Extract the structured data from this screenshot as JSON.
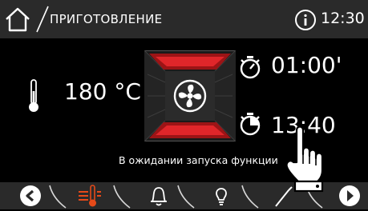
{
  "header": {
    "title": "ПРИГОТОВЛЕНИЕ",
    "time": "12:30"
  },
  "main": {
    "temperature": "180 °C",
    "duration": "01:00'",
    "end_time": "13:40",
    "status": "В ожидании запуска функции"
  },
  "icons": {
    "home": "home-icon",
    "info": "info-icon",
    "thermometer": "thermometer-icon",
    "fan": "fan-icon",
    "stopwatch": "stopwatch-icon",
    "end-time": "end-time-icon",
    "back": "back-icon",
    "heating": "heating-icon",
    "bell": "bell-icon",
    "lamp": "lamp-icon",
    "probe": "probe-icon",
    "forward": "forward-icon",
    "hand": "hand-pointer-icon"
  },
  "colors": {
    "accent": "#e64a19",
    "heater_red": "#e0262a",
    "bar": "#2a2a2a"
  }
}
